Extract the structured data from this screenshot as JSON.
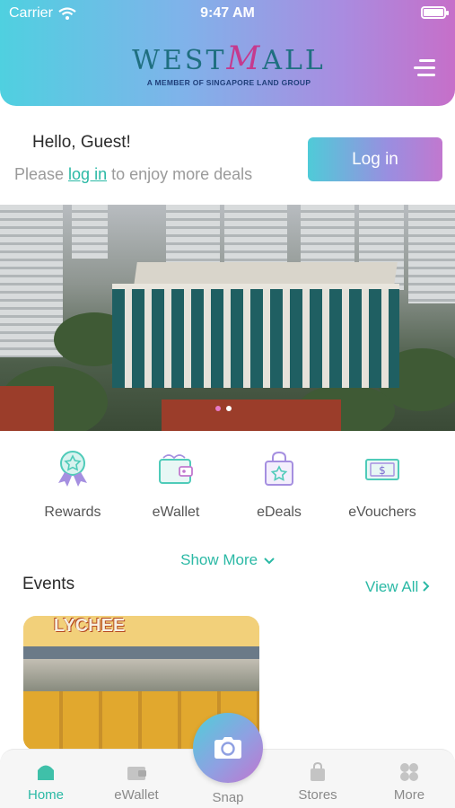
{
  "status_bar": {
    "carrier": "Carrier",
    "time": "9:47 AM"
  },
  "brand": {
    "logo_text_pre": "WEST",
    "logo_text_m": "M",
    "logo_text_post": "ALL",
    "tagline": "A MEMBER OF SINGAPORE LAND GROUP"
  },
  "greeting": {
    "hello": "Hello, Guest!",
    "prompt_pre": "Please ",
    "prompt_link": "log in",
    "prompt_post": " to enjoy more deals",
    "login_button": "Log in"
  },
  "carousel": {
    "slide_count": 2,
    "active_index": 1
  },
  "quick_actions": [
    {
      "label": "Rewards",
      "icon": "rewards-badge-icon"
    },
    {
      "label": "eWallet",
      "icon": "wallet-icon"
    },
    {
      "label": "eDeals",
      "icon": "shopping-bag-star-icon"
    },
    {
      "label": "eVouchers",
      "icon": "voucher-dollar-icon"
    }
  ],
  "show_more": "Show More",
  "events": {
    "title": "Events",
    "view_all": "View All",
    "card_sign_text": "LYCHEE"
  },
  "tabbar": {
    "items": [
      {
        "label": "Home",
        "icon": "home-icon",
        "active": true
      },
      {
        "label": "eWallet",
        "icon": "wallet-icon",
        "active": false
      },
      {
        "label": "Snap",
        "icon": "camera-icon",
        "active": false
      },
      {
        "label": "Stores",
        "icon": "bag-icon",
        "active": false
      },
      {
        "label": "More",
        "icon": "grid-icon",
        "active": false
      }
    ]
  },
  "colors": {
    "accent_teal": "#2bb9a5",
    "gradient_start": "#4fd0e0",
    "gradient_end": "#c66fc9"
  }
}
